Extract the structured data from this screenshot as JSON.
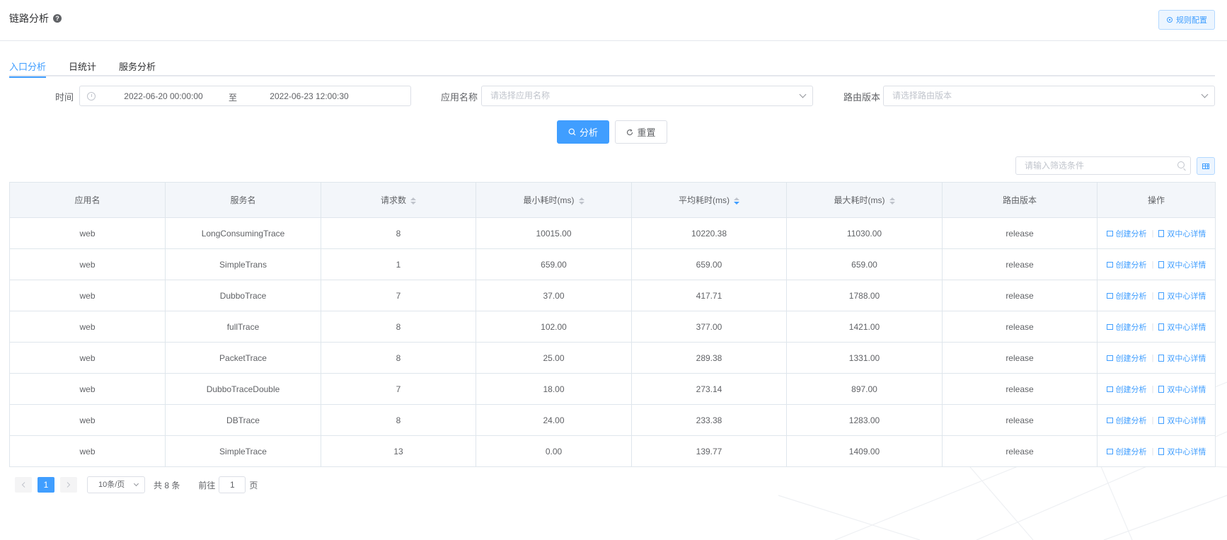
{
  "header": {
    "title": "链路分析",
    "help_glyph": "?",
    "rule_button_label": "规则配置"
  },
  "tabs": [
    {
      "label": "入口分析",
      "active": true
    },
    {
      "label": "日统计",
      "active": false
    },
    {
      "label": "服务分析",
      "active": false
    }
  ],
  "filters": {
    "time_label": "时间",
    "time_start": "2022-06-20 00:00:00",
    "time_separator": "至",
    "time_end": "2022-06-23 12:00:30",
    "app_label": "应用名称",
    "app_placeholder": "请选择应用名称",
    "route_label": "路由版本",
    "route_placeholder": "请选择路由版本"
  },
  "actions": {
    "analyze_label": "分析",
    "reset_label": "重置"
  },
  "table_search": {
    "placeholder": "请输入筛选条件"
  },
  "table": {
    "columns": [
      "应用名",
      "服务名",
      "请求数",
      "最小耗时(ms)",
      "平均耗时(ms)",
      "最大耗时(ms)",
      "路由版本",
      "操作"
    ],
    "sorted_column": "平均耗时(ms)",
    "sort_direction": "descending",
    "op_labels": {
      "create": "创建分析",
      "detail": "双中心详情"
    },
    "rows": [
      {
        "app": "web",
        "service": "LongConsumingTrace",
        "requests": "8",
        "min": "10015.00",
        "avg": "10220.38",
        "max": "11030.00",
        "route": "release"
      },
      {
        "app": "web",
        "service": "SimpleTrans",
        "requests": "1",
        "min": "659.00",
        "avg": "659.00",
        "max": "659.00",
        "route": "release"
      },
      {
        "app": "web",
        "service": "DubboTrace",
        "requests": "7",
        "min": "37.00",
        "avg": "417.71",
        "max": "1788.00",
        "route": "release"
      },
      {
        "app": "web",
        "service": "fullTrace",
        "requests": "8",
        "min": "102.00",
        "avg": "377.00",
        "max": "1421.00",
        "route": "release"
      },
      {
        "app": "web",
        "service": "PacketTrace",
        "requests": "8",
        "min": "25.00",
        "avg": "289.38",
        "max": "1331.00",
        "route": "release"
      },
      {
        "app": "web",
        "service": "DubboTraceDouble",
        "requests": "7",
        "min": "18.00",
        "avg": "273.14",
        "max": "897.00",
        "route": "release"
      },
      {
        "app": "web",
        "service": "DBTrace",
        "requests": "8",
        "min": "24.00",
        "avg": "233.38",
        "max": "1283.00",
        "route": "release"
      },
      {
        "app": "web",
        "service": "SimpleTrace",
        "requests": "13",
        "min": "0.00",
        "avg": "139.77",
        "max": "1409.00",
        "route": "release"
      }
    ]
  },
  "pagination": {
    "current_page": "1",
    "page_size_label": "10条/页",
    "total_label": "共 8 条",
    "jump_prefix": "前往",
    "jump_value": "1",
    "jump_suffix": "页"
  },
  "colors": {
    "primary": "#409eff",
    "header_bg": "#f3f6fa",
    "border": "#dfe6ec"
  }
}
